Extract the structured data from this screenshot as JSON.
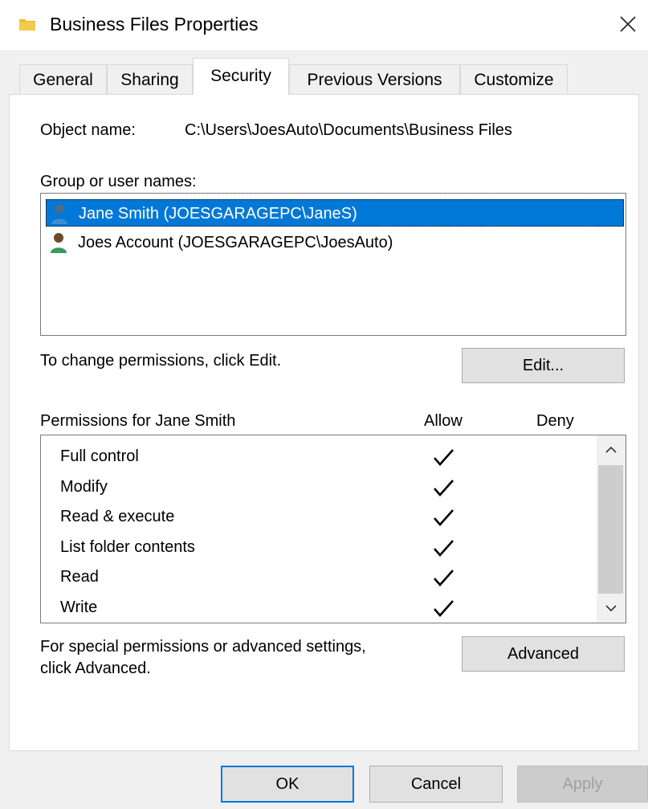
{
  "window": {
    "title": "Business Files Properties",
    "title_icon": "folder-icon",
    "close_icon": "close-icon"
  },
  "tabs": [
    {
      "label": "General",
      "active": false
    },
    {
      "label": "Sharing",
      "active": false
    },
    {
      "label": "Security",
      "active": true
    },
    {
      "label": "Previous Versions",
      "active": false
    },
    {
      "label": "Customize",
      "active": false
    }
  ],
  "security": {
    "object_name_label": "Object name:",
    "object_name_value": "C:\\Users\\JoesAuto\\Documents\\Business Files",
    "group_label": "Group or user names:",
    "users": [
      {
        "name": "Jane Smith (JOESGARAGEPC\\JaneS)",
        "selected": true,
        "icon": "user-icon"
      },
      {
        "name": "Joes Account (JOESGARAGEPC\\JoesAuto)",
        "selected": false,
        "icon": "user-icon"
      }
    ],
    "change_hint": "To change permissions, click Edit.",
    "edit_button": "Edit...",
    "permissions_label": "Permissions for Jane Smith",
    "allow_header": "Allow",
    "deny_header": "Deny",
    "permissions": [
      {
        "name": "Full control",
        "allow": true,
        "deny": false
      },
      {
        "name": "Modify",
        "allow": true,
        "deny": false
      },
      {
        "name": "Read & execute",
        "allow": true,
        "deny": false
      },
      {
        "name": "List folder contents",
        "allow": true,
        "deny": false
      },
      {
        "name": "Read",
        "allow": true,
        "deny": false
      },
      {
        "name": "Write",
        "allow": true,
        "deny": false
      }
    ],
    "advanced_hint_line1": "For special permissions or advanced settings,",
    "advanced_hint_line2": "click Advanced.",
    "advanced_button": "Advanced"
  },
  "footer": {
    "ok": "OK",
    "cancel": "Cancel",
    "apply": "Apply"
  },
  "colors": {
    "selection": "#0078d7",
    "default_button_border": "#0078d7"
  }
}
